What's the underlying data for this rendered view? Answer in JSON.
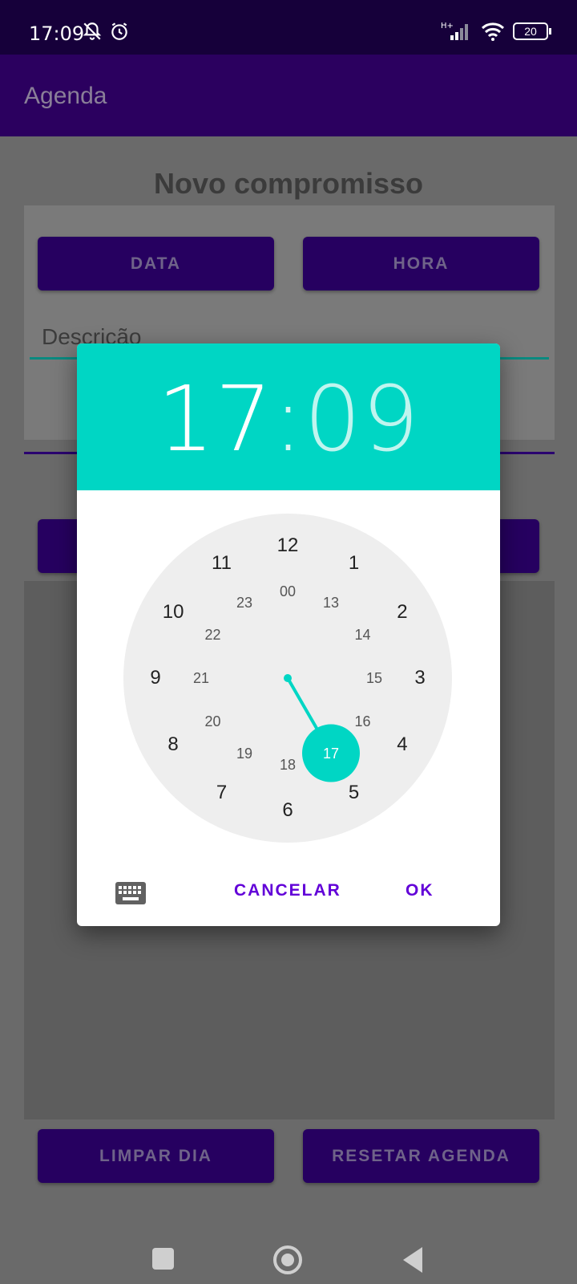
{
  "status_bar": {
    "time": "17:09",
    "battery": "20"
  },
  "app_bar": {
    "title": "Agenda"
  },
  "page": {
    "heading": "Novo compromisso",
    "data_button": "DATA",
    "hora_button": "HORA",
    "description_placeholder": "Descrição",
    "limpar_button": "LIMPAR DIA",
    "resetar_button": "RESETAR AGENDA"
  },
  "time_picker": {
    "hour": "17",
    "separator": ":",
    "minute": "09",
    "selected_hour": 17,
    "outer_hours": [
      "12",
      "1",
      "2",
      "3",
      "4",
      "5",
      "6",
      "7",
      "8",
      "9",
      "10",
      "11"
    ],
    "inner_hours": [
      "00",
      "13",
      "14",
      "15",
      "16",
      "17",
      "18",
      "19",
      "20",
      "21",
      "22",
      "23"
    ],
    "cancel_label": "CANCELAR",
    "ok_label": "OK",
    "accent_color": "#00d6c4",
    "action_color": "#6200d8"
  },
  "icons": [
    "notifications-off-icon",
    "alarm-icon",
    "signal-icon",
    "wifi-icon",
    "battery-icon",
    "keyboard-icon",
    "nav-recents-icon",
    "nav-home-icon",
    "nav-back-icon"
  ]
}
